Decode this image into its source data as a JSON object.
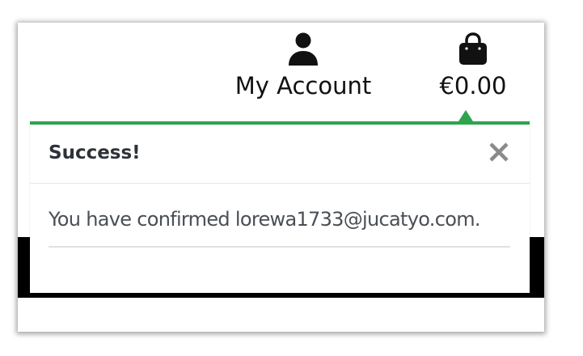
{
  "nav": {
    "account": {
      "icon": "user-icon",
      "label": "My Account"
    },
    "bag": {
      "icon": "shopping-bag-icon",
      "total": "€0.00"
    }
  },
  "toast": {
    "title": "Success!",
    "message": "You have confirmed lorewa1733@jucatyo.com.",
    "close_icon": "close-icon",
    "accent_color": "#2ea44f"
  }
}
